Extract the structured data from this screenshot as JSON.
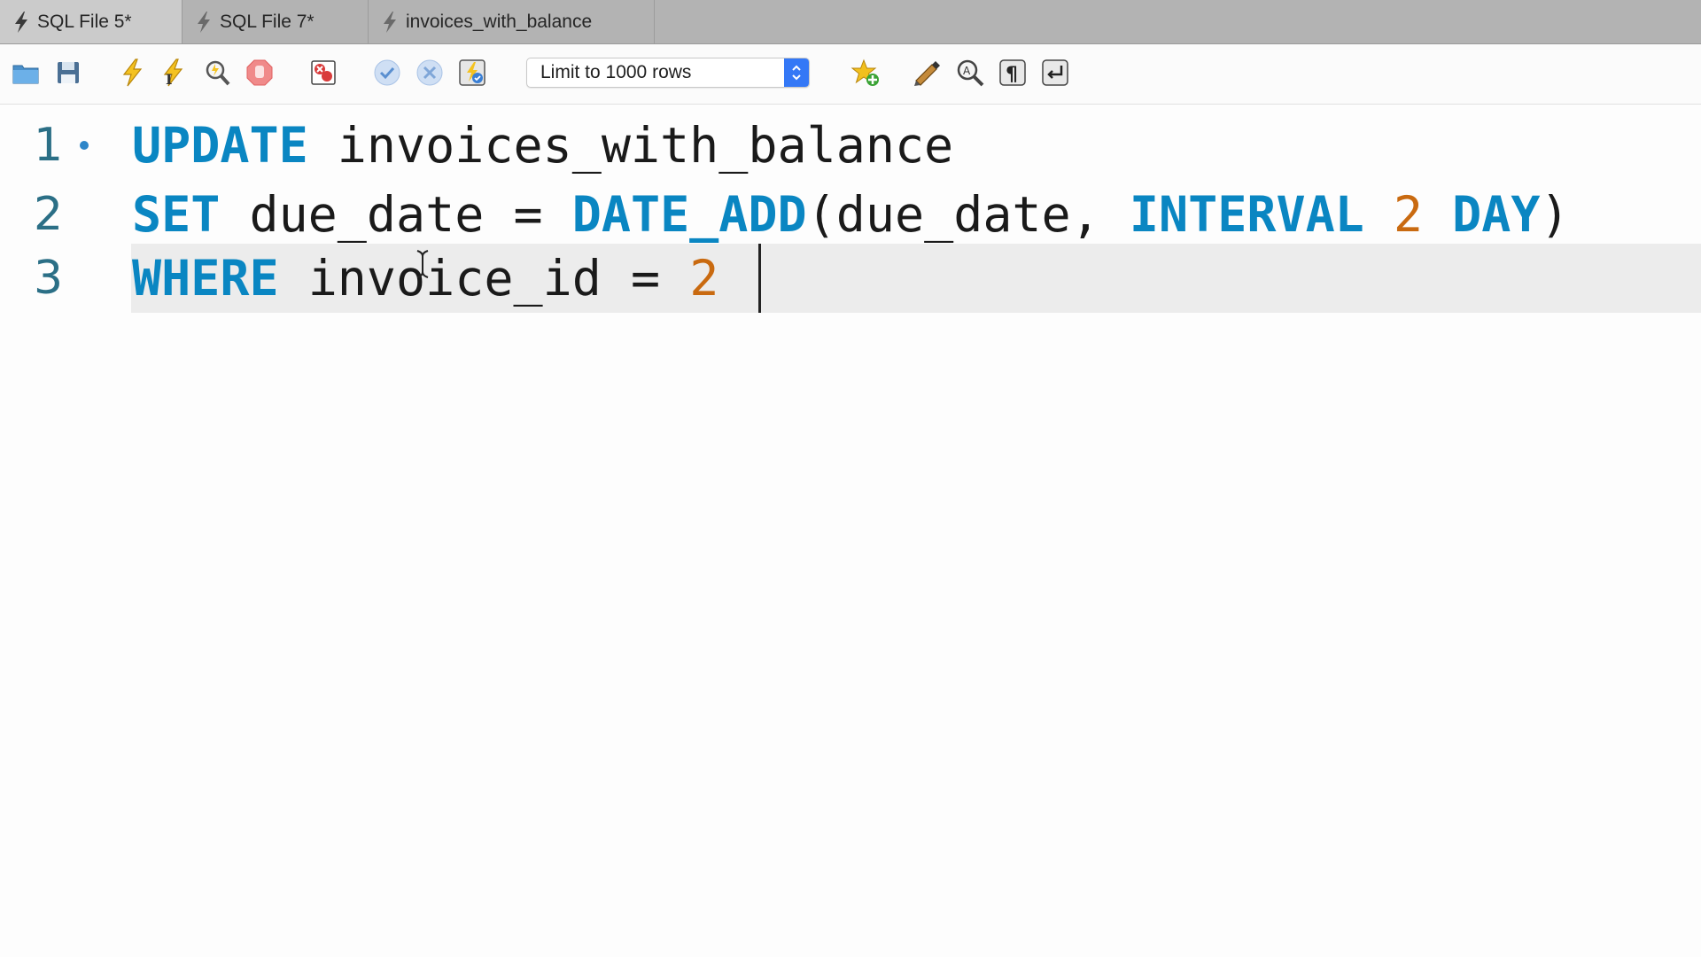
{
  "tabs": [
    {
      "label": "SQL File 5*",
      "active": true
    },
    {
      "label": "SQL File 7*",
      "active": false
    },
    {
      "label": "invoices_with_balance",
      "active": false
    }
  ],
  "toolbar": {
    "limit_select": "Limit to 1000 rows",
    "icons": [
      "open-folder-icon",
      "save-icon",
      "execute-icon",
      "execute-current-icon",
      "explain-icon",
      "stop-icon",
      "toggle-error-stop-icon",
      "commit-icon",
      "rollback-icon",
      "autocommit-icon",
      "add-snippet-icon",
      "beautify-icon",
      "find-icon",
      "invisible-chars-icon",
      "wrap-lines-icon"
    ]
  },
  "editor": {
    "line_numbers": [
      "1",
      "2",
      "3"
    ],
    "lines": [
      {
        "tokens": [
          "UPDATE",
          " invoices_with_balance"
        ]
      },
      {
        "tokens": [
          "SET",
          " due_date ",
          "=",
          " ",
          "DATE_ADD",
          "(due_date, ",
          "INTERVAL",
          " ",
          "2",
          " ",
          "DAY",
          ")"
        ]
      },
      {
        "tokens": [
          "WHERE",
          " invoice_id ",
          "=",
          " ",
          "2"
        ]
      }
    ]
  },
  "colors": {
    "keyword": "#0a86c2",
    "number": "#c96a10",
    "line_number": "#2b6f86",
    "current_line": "#ececec",
    "accent": "#3478f6"
  }
}
